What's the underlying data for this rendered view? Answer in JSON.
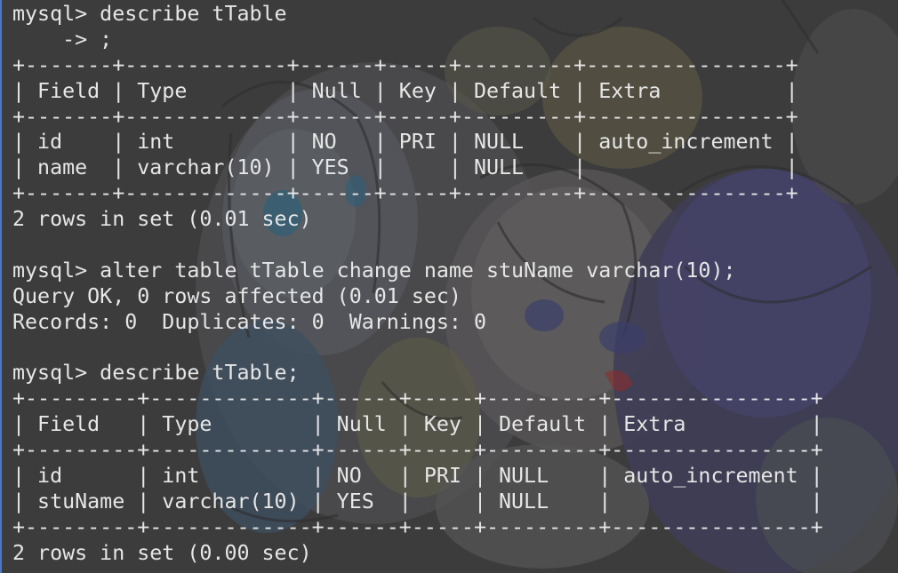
{
  "terminal": {
    "lines": [
      "mysql> describe tTable",
      "    -> ;",
      "+-------+-------------+------+-----+---------+----------------+",
      "| Field | Type        | Null | Key | Default | Extra          |",
      "+-------+-------------+------+-----+---------+----------------+",
      "| id    | int         | NO   | PRI | NULL    | auto_increment |",
      "| name  | varchar(10) | YES  |     | NULL    |                |",
      "+-------+-------------+------+-----+---------+----------------+",
      "2 rows in set (0.01 sec)",
      "",
      "mysql> alter table tTable change name stuName varchar(10);",
      "Query OK, 0 rows affected (0.01 sec)",
      "Records: 0  Duplicates: 0  Warnings: 0",
      "",
      "mysql> describe tTable;",
      "+---------+-------------+------+-----+---------+----------------+",
      "| Field   | Type        | Null | Key | Default | Extra          |",
      "+---------+-------------+------+-----+---------+----------------+",
      "| id      | int         | NO   | PRI | NULL    | auto_increment |",
      "| stuName | varchar(10) | YES  |     | NULL    |                |",
      "+---------+-------------+------+-----+---------+----------------+",
      "2 rows in set (0.00 sec)"
    ]
  },
  "colors": {
    "background": "#3a3a3a",
    "text": "#e6e6e6",
    "accent_border": "#4a78c8"
  }
}
